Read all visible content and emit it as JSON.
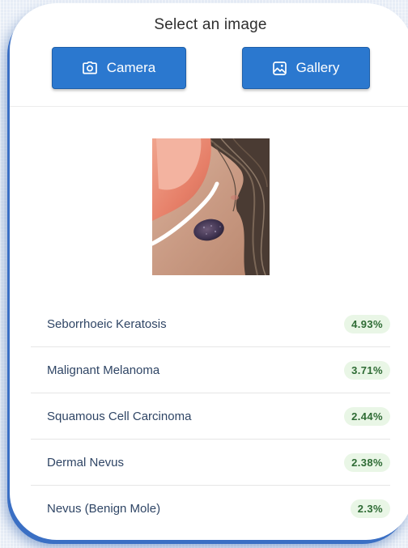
{
  "header": {
    "title": "Select an image"
  },
  "buttons": {
    "camera_label": "Camera",
    "camera_icon": "camera-icon",
    "gallery_label": "Gallery",
    "gallery_icon": "image-icon"
  },
  "colors": {
    "primary_button": "#2b78cf",
    "badge_bg": "#e9f6e6",
    "badge_text": "#2e6b34",
    "condition_text": "#2f4565"
  },
  "results": [
    {
      "condition": "Seborrhoeic Keratosis",
      "confidence": "4.93%"
    },
    {
      "condition": "Malignant Melanoma",
      "confidence": "3.71%"
    },
    {
      "condition": "Squamous Cell Carcinoma",
      "confidence": "2.44%"
    },
    {
      "condition": "Dermal Nevus",
      "confidence": "2.38%"
    },
    {
      "condition": "Nevus (Benign Mole)",
      "confidence": "2.3%"
    }
  ]
}
